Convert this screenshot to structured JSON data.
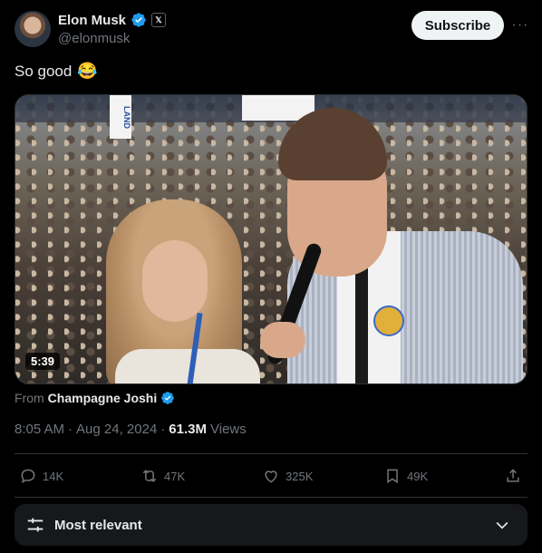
{
  "author": {
    "display_name": "Elon Musk",
    "handle": "@elonmusk",
    "affiliation_badge": "𝕏"
  },
  "header": {
    "subscribe_label": "Subscribe",
    "more_label": "···"
  },
  "tweet": {
    "text": "So good",
    "emoji": "😂"
  },
  "media": {
    "duration": "5:39",
    "sign_text": "LAND"
  },
  "source": {
    "prefix": "From",
    "name": "Champagne Joshi"
  },
  "meta": {
    "time": "8:05 AM",
    "separator": "·",
    "date": "Aug 24, 2024",
    "views_count": "61.3M",
    "views_label": "Views"
  },
  "actions": {
    "replies": "14K",
    "reposts": "47K",
    "likes": "325K",
    "bookmarks": "49K"
  },
  "sort": {
    "label": "Most relevant"
  },
  "colors": {
    "verified": "#1d9bf0",
    "text": "#e7e9ea",
    "muted": "#71767b",
    "background": "#000000"
  }
}
